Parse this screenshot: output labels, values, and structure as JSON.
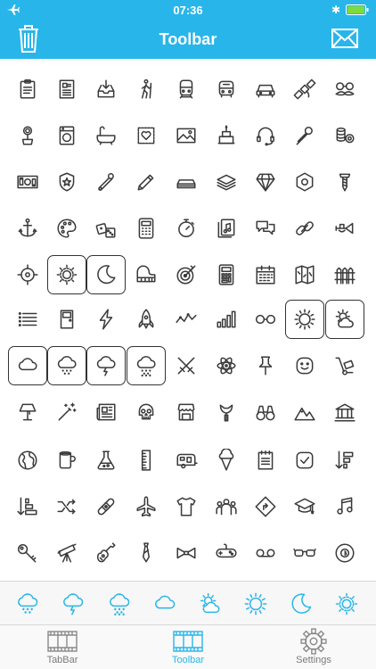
{
  "status_bar": {
    "time": "07:36",
    "airplane_icon": "airplane-icon",
    "bluetooth": "✱",
    "battery_icon": "battery-icon"
  },
  "nav": {
    "title": "Toolbar",
    "left_icon": "trash-icon",
    "right_icon": "mail-icon"
  },
  "colors": {
    "accent": "#28b6ea",
    "icon_stroke": "#3a3a3a",
    "box_border": "#333333"
  },
  "grid": {
    "rows": [
      [
        {
          "icon": "clipboard"
        },
        {
          "icon": "document"
        },
        {
          "icon": "inbox"
        },
        {
          "icon": "hiker"
        },
        {
          "icon": "train"
        },
        {
          "icon": "bus"
        },
        {
          "icon": "car"
        },
        {
          "icon": "satellite"
        },
        {
          "icon": "mustache"
        }
      ],
      [
        {
          "icon": "flower-pot"
        },
        {
          "icon": "washing-machine"
        },
        {
          "icon": "bathtub"
        },
        {
          "icon": "stamp-heart"
        },
        {
          "icon": "picture"
        },
        {
          "icon": "cake"
        },
        {
          "icon": "headset"
        },
        {
          "icon": "microphone"
        },
        {
          "icon": "coins"
        }
      ],
      [
        {
          "icon": "money"
        },
        {
          "icon": "shield-star"
        },
        {
          "icon": "safety-pin"
        },
        {
          "icon": "pencil"
        },
        {
          "icon": "paper-stack"
        },
        {
          "icon": "layers"
        },
        {
          "icon": "diamond"
        },
        {
          "icon": "hex-nut"
        },
        {
          "icon": "screw"
        }
      ],
      [
        {
          "icon": "anchor"
        },
        {
          "icon": "palette"
        },
        {
          "icon": "dice"
        },
        {
          "icon": "calculator-old"
        },
        {
          "icon": "stopwatch"
        },
        {
          "icon": "music-file"
        },
        {
          "icon": "chat"
        },
        {
          "icon": "link"
        },
        {
          "icon": "trumpet"
        }
      ],
      [
        {
          "icon": "crosshair"
        },
        {
          "icon": "sun-day",
          "boxed": true
        },
        {
          "icon": "moon",
          "boxed": true
        },
        {
          "icon": "piano",
          "boxed": false
        },
        {
          "icon": "target"
        },
        {
          "icon": "calculator"
        },
        {
          "icon": "calendar"
        },
        {
          "icon": "map"
        },
        {
          "icon": "fence"
        }
      ],
      [
        {
          "icon": "list"
        },
        {
          "icon": "door"
        },
        {
          "icon": "lightning"
        },
        {
          "icon": "rocket"
        },
        {
          "icon": "line-graph"
        },
        {
          "icon": "bar-graph"
        },
        {
          "icon": "glasses-round"
        },
        {
          "icon": "sun",
          "boxed": true
        },
        {
          "icon": "sun-cloud",
          "boxed": true
        }
      ],
      [
        {
          "icon": "cloud",
          "boxed": true
        },
        {
          "icon": "cloud-snow",
          "boxed": true
        },
        {
          "icon": "cloud-lightning",
          "boxed": true
        },
        {
          "icon": "cloud-hail",
          "boxed": true
        },
        {
          "icon": "swords"
        },
        {
          "icon": "atom"
        },
        {
          "icon": "pushpin"
        },
        {
          "icon": "smiley"
        },
        {
          "icon": "hand-truck"
        }
      ],
      [
        {
          "icon": "lamp"
        },
        {
          "icon": "magic-wand"
        },
        {
          "icon": "newspaper"
        },
        {
          "icon": "skull"
        },
        {
          "icon": "shop"
        },
        {
          "icon": "slingshot"
        },
        {
          "icon": "binoculars"
        },
        {
          "icon": "mountains"
        },
        {
          "icon": "bank"
        }
      ],
      [
        {
          "icon": "globe"
        },
        {
          "icon": "mug"
        },
        {
          "icon": "flask"
        },
        {
          "icon": "ruler"
        },
        {
          "icon": "caravan"
        },
        {
          "icon": "ice-cream"
        },
        {
          "icon": "notepad"
        },
        {
          "icon": "check-box"
        },
        {
          "icon": "sort-down"
        }
      ],
      [
        {
          "icon": "sort-bars"
        },
        {
          "icon": "shuffle"
        },
        {
          "icon": "bandage"
        },
        {
          "icon": "airplane"
        },
        {
          "icon": "t-shirt"
        },
        {
          "icon": "crowd"
        },
        {
          "icon": "road-sign"
        },
        {
          "icon": "graduation-cap"
        },
        {
          "icon": "music-note"
        }
      ],
      [
        {
          "icon": "key"
        },
        {
          "icon": "telescope"
        },
        {
          "icon": "guitar"
        },
        {
          "icon": "tie"
        },
        {
          "icon": "bow-tie"
        },
        {
          "icon": "gamepad"
        },
        {
          "icon": "voicemail"
        },
        {
          "icon": "glasses"
        },
        {
          "icon": "billiard-ball"
        }
      ]
    ]
  },
  "weather_bar": [
    "cloud-snow",
    "cloud-lightning",
    "cloud-hail",
    "cloud",
    "sun-cloud",
    "sun",
    "moon",
    "sun-day"
  ],
  "tabs": [
    {
      "label": "TabBar",
      "icon": "film-icon",
      "active": false
    },
    {
      "label": "Toolbar",
      "icon": "film-icon",
      "active": true
    },
    {
      "label": "Settings",
      "icon": "gear-icon",
      "active": false
    }
  ]
}
